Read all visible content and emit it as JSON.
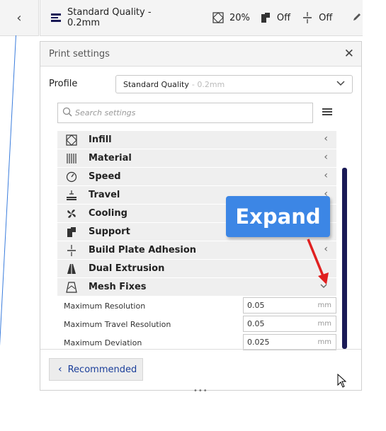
{
  "topbar": {
    "profile_name": "Standard Quality - 0.2mm",
    "infill": "20%",
    "support": "Off",
    "adhesion": "Off"
  },
  "panel": {
    "title": "Print settings",
    "profile_label": "Profile",
    "profile_value": "Standard Quality",
    "profile_value_muted": "- 0.2mm",
    "search_placeholder": "Search settings",
    "categories": [
      {
        "label": "Infill",
        "icon": "infill-icon"
      },
      {
        "label": "Material",
        "icon": "material-icon"
      },
      {
        "label": "Speed",
        "icon": "speed-icon"
      },
      {
        "label": "Travel",
        "icon": "travel-icon"
      },
      {
        "label": "Cooling",
        "icon": "cooling-icon"
      },
      {
        "label": "Support",
        "icon": "support-icon"
      },
      {
        "label": "Build Plate Adhesion",
        "icon": "adhesion-icon"
      },
      {
        "label": "Dual Extrusion",
        "icon": "dual-extrusion-icon"
      },
      {
        "label": "Mesh Fixes",
        "icon": "mesh-fixes-icon"
      }
    ],
    "settings": [
      {
        "label": "Maximum Resolution",
        "value": "0.05",
        "unit": "mm"
      },
      {
        "label": "Maximum Travel Resolution",
        "value": "0.05",
        "unit": "mm"
      },
      {
        "label": "Maximum Deviation",
        "value": "0.025",
        "unit": "mm"
      }
    ],
    "recommended_label": "Recommended"
  },
  "annotation": {
    "callout_text": "Expand",
    "callout_color": "#3c86e5",
    "arrow_color": "#e02020"
  },
  "colors": {
    "accent": "#1a3e9a",
    "scrollbar": "#1a1a56"
  }
}
